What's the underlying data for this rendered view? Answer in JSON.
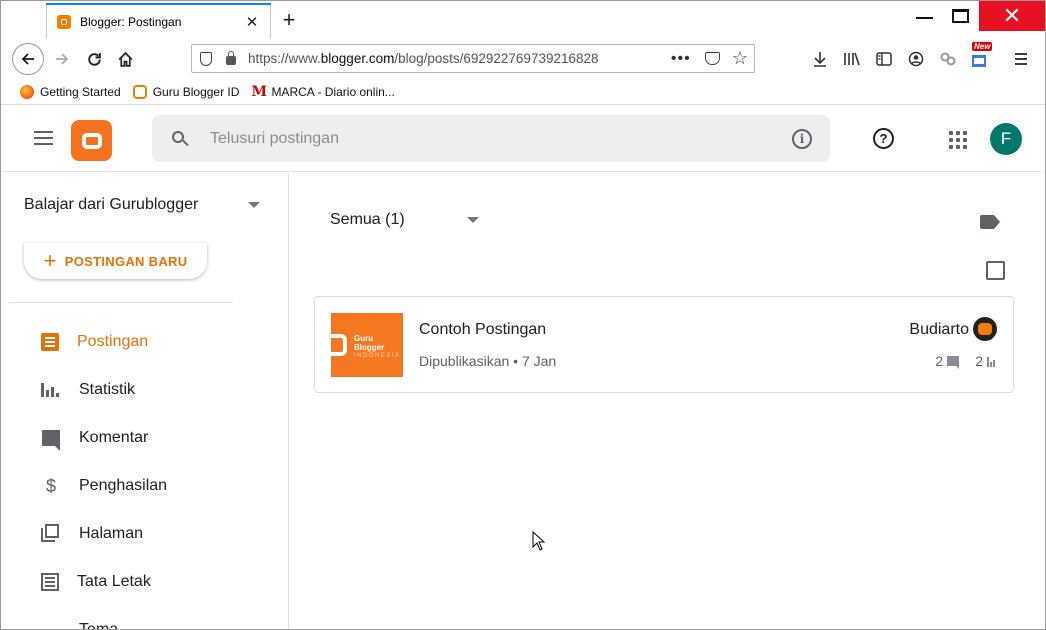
{
  "browser": {
    "tab_title": "Blogger: Postingan",
    "url_prefix": "https://www.",
    "url_domain": "blogger.com",
    "url_path": "/blog/posts/692922769739216828",
    "url_dots": "•••",
    "bookmarks": [
      {
        "label": "Getting Started"
      },
      {
        "label": "Guru Blogger ID"
      },
      {
        "label": "MARCA - Diario onlin..."
      }
    ],
    "new_badge": "New"
  },
  "app": {
    "search_placeholder": "Telusuri postingan",
    "avatar_letter": "F"
  },
  "sidebar": {
    "blog_name": "Balajar dari Gurublogger",
    "new_post_label": "POSTINGAN BARU",
    "items": [
      {
        "label": "Postingan",
        "active": true
      },
      {
        "label": "Statistik"
      },
      {
        "label": "Komentar"
      },
      {
        "label": "Penghasilan"
      },
      {
        "label": "Halaman"
      },
      {
        "label": "Tata Letak"
      },
      {
        "label": "Tema"
      }
    ]
  },
  "main": {
    "filter_label": "Semua (1)",
    "posts": [
      {
        "title": "Contoh Postingan",
        "status": "Dipublikasikan • 7 Jan",
        "author": "Budiarto",
        "comments": "2",
        "views": "2",
        "thumb_lines": [
          "Guru",
          "Blogger",
          "INDONESIA"
        ]
      }
    ]
  },
  "colors": {
    "accent": "#e8710a",
    "avatar": "#00796b",
    "close_button": "#e81123"
  }
}
